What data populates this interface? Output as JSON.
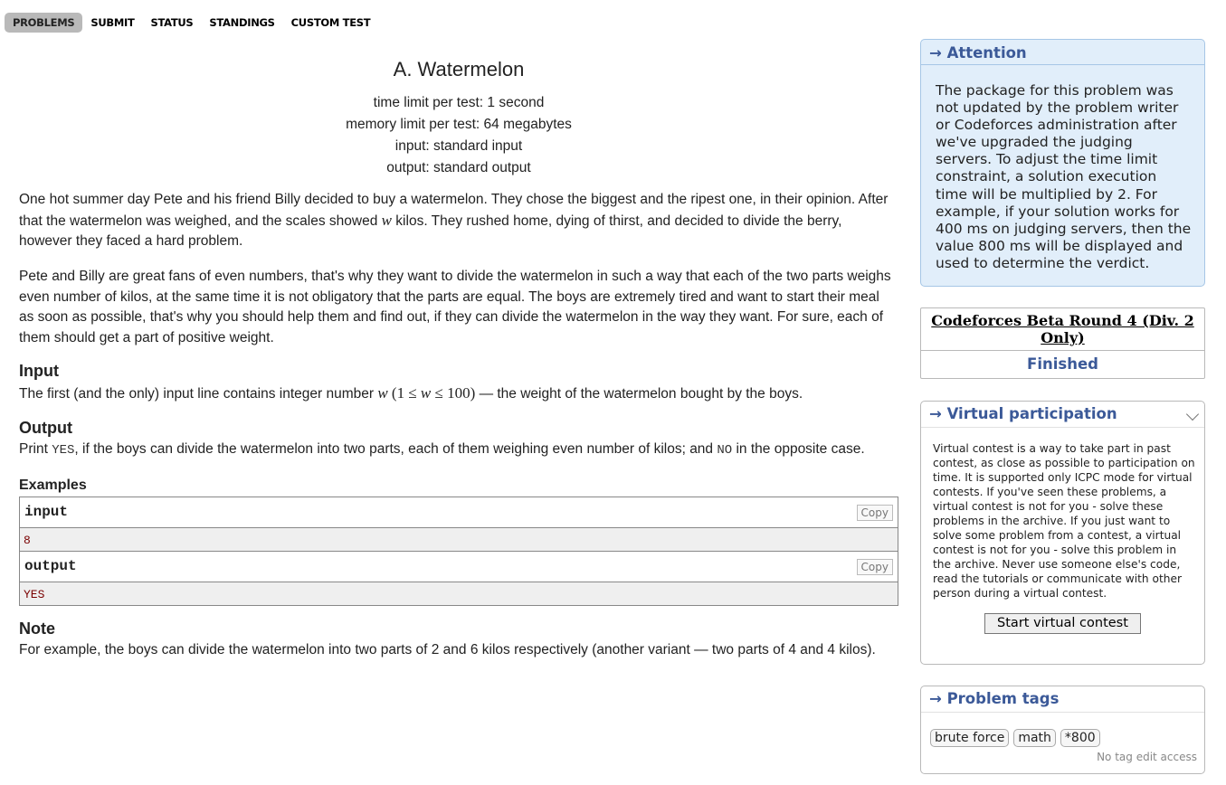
{
  "nav": {
    "tabs": [
      "PROBLEMS",
      "SUBMIT",
      "STATUS",
      "STANDINGS",
      "CUSTOM TEST"
    ]
  },
  "problem": {
    "title": "A. Watermelon",
    "time_limit": "time limit per test: 1 second",
    "memory_limit": "memory limit per test: 64 megabytes",
    "input": "input: standard input",
    "output": "output: standard output",
    "statement_p1_a": "One hot summer day Pete and his friend Billy decided to buy a watermelon. They chose the biggest and the ripest one, in their opinion. After that the watermelon was weighed, and the scales showed ",
    "statement_p1_var": "w",
    "statement_p1_b": " kilos. They rushed home, dying of thirst, and decided to divide the berry, however they faced a hard problem.",
    "statement_p2": "Pete and Billy are great fans of even numbers, that's why they want to divide the watermelon in such a way that each of the two parts weighs even number of kilos, at the same time it is not obligatory that the parts are equal. The boys are extremely tired and want to start their meal as soon as possible, that's why you should help them and find out, if they can divide the watermelon in the way they want. For sure, each of them should get a part of positive weight.",
    "input_title": "Input",
    "input_text_a": "The first (and the only) input line contains integer number ",
    "input_var": "w",
    "input_math_open": " (1 ≤ ",
    "input_math_var": "w",
    "input_math_close": " ≤ 100)",
    "input_text_b": " — the weight of the watermelon bought by the boys.",
    "output_title": "Output",
    "output_text_a": "Print ",
    "output_yes": "YES",
    "output_text_b": ", if the boys can divide the watermelon into two parts, each of them weighing even number of kilos; and ",
    "output_no": "NO",
    "output_text_c": " in the opposite case.",
    "examples_title": "Examples",
    "example_input_label": "input",
    "example_input_value": "8",
    "example_output_label": "output",
    "example_output_value": "YES",
    "copy_label": "Copy",
    "note_title": "Note",
    "note_text": "For example, the boys can divide the watermelon into two parts of 2 and 6 kilos respectively (another variant — two parts of 4 and 4 kilos)."
  },
  "sidebar": {
    "attention_title": "→ Attention",
    "attention_text": "The package for this problem was not updated by the problem writer or Codeforces administration after we've upgraded the judging servers. To adjust the time limit constraint, a solution execution time will be multiplied by 2. For example, if your solution works for 400 ms on judging servers, then the value 800 ms will be displayed and used to determine the verdict.",
    "round_name": "Codeforces Beta Round 4 (Div. 2 Only)",
    "round_status": "Finished",
    "virtual_title": "→ Virtual participation",
    "virtual_text": "Virtual contest is a way to take part in past contest, as close as possible to participation on time. It is supported only ICPC mode for virtual contests. If you've seen these problems, a virtual contest is not for you - solve these problems in the archive. If you just want to solve some problem from a contest, a virtual contest is not for you - solve this problem in the archive. Never use someone else's code, read the tutorials or communicate with other person during a virtual contest.",
    "virtual_button": "Start virtual contest",
    "tags_title": "→ Problem tags",
    "tags": [
      "brute force",
      "math",
      "*800"
    ],
    "no_tag_edit": "No tag edit access"
  }
}
